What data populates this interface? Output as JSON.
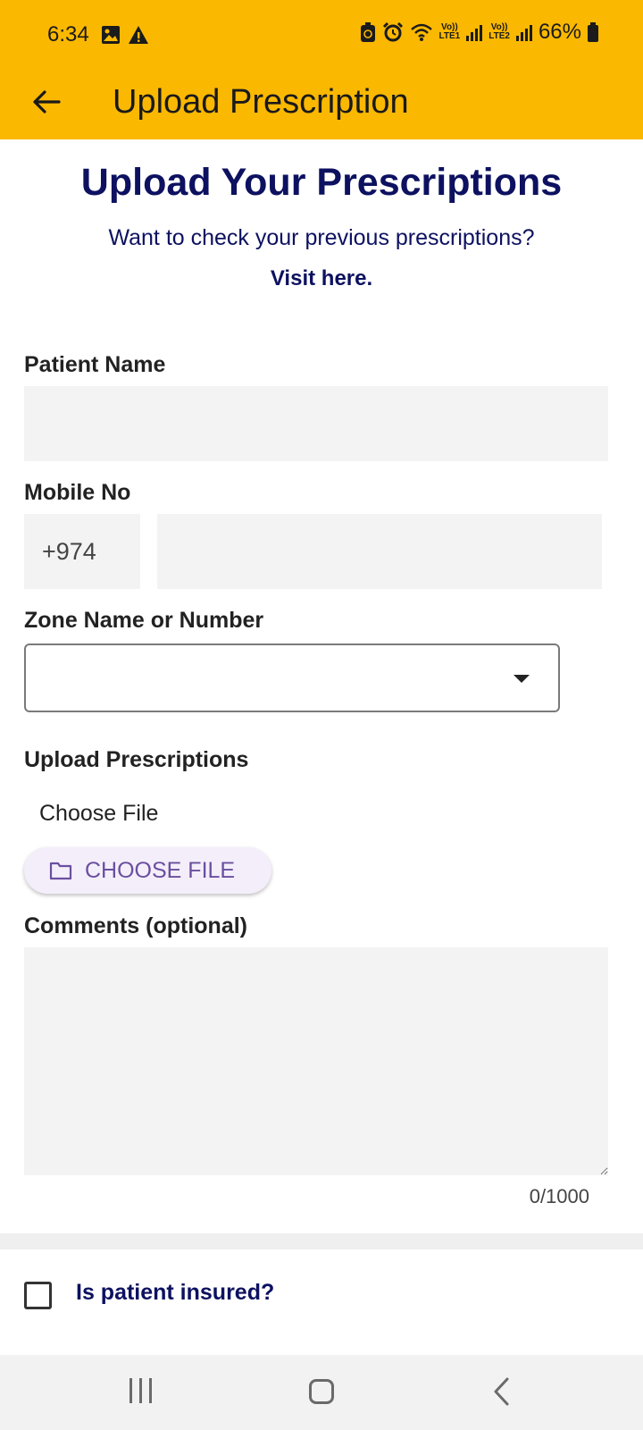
{
  "status_bar": {
    "time": "6:34",
    "battery": "66%",
    "sim1": {
      "volte": "Vo))",
      "net": "LTE1"
    },
    "sim2": {
      "volte": "Vo))",
      "net": "LTE2"
    },
    "icons": [
      "gallery-icon",
      "warning-icon",
      "battery-saver-icon",
      "alarm-icon",
      "wifi-icon",
      "signal-icon",
      "battery-icon"
    ]
  },
  "app_bar": {
    "title": "Upload Prescription",
    "back_icon": "arrow-left-icon",
    "color": "#FBB800"
  },
  "header": {
    "heading": "Upload Your Prescriptions",
    "subtitle": "Want to check your previous prescriptions?",
    "link": "Visit here."
  },
  "form": {
    "patient_name": {
      "label": "Patient Name",
      "value": ""
    },
    "mobile": {
      "label": "Mobile No",
      "country_code": "+974",
      "value": ""
    },
    "zone": {
      "label": "Zone Name or Number",
      "selected": ""
    },
    "upload": {
      "label": "Upload Prescriptions",
      "file_text": "Choose File",
      "button_label": "CHOOSE FILE"
    },
    "comments": {
      "label": "Comments (optional)",
      "value": "",
      "counter": "0/1000"
    },
    "insured": {
      "label": "Is patient insured?",
      "checked": false
    }
  },
  "colors": {
    "primary_text": "#0d1160",
    "accent": "#6a4fa0",
    "field_bg": "#f3f3f3"
  }
}
